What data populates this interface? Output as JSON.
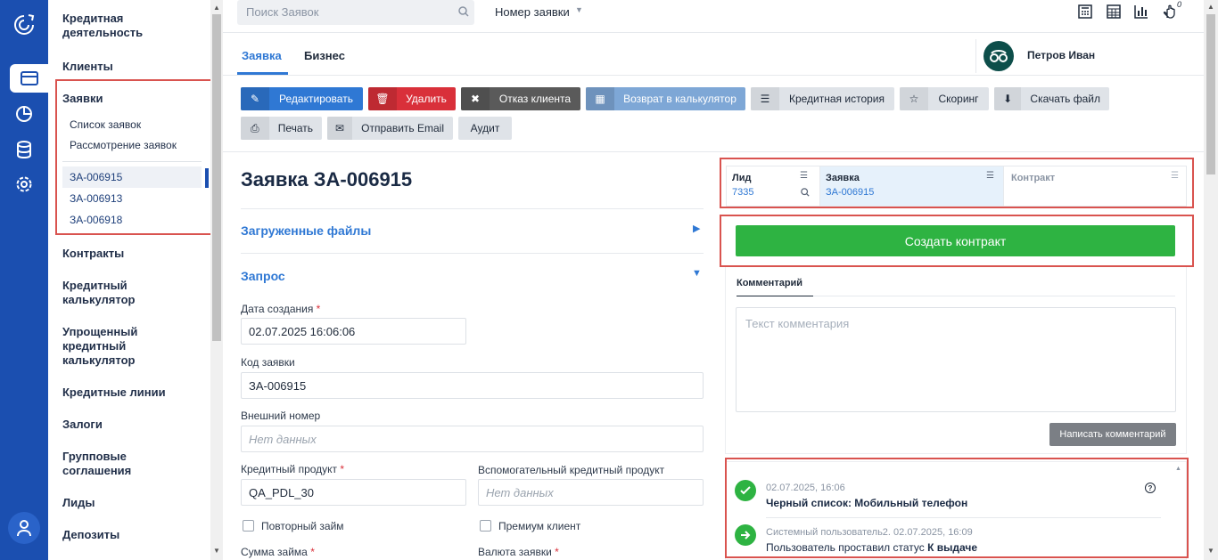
{
  "rail": {
    "items": [
      "logo-icon",
      "card-icon",
      "pie-chart-icon",
      "database-icon",
      "settings-icon",
      "user-icon"
    ]
  },
  "sidebar": {
    "title": "Кредитная деятельность",
    "clients": "Клиенты",
    "applications": "Заявки",
    "app_list": "Список заявок",
    "app_review": "Рассмотрение заявок",
    "recent": [
      "ЗА-006915",
      "ЗА-006913",
      "ЗА-006918"
    ],
    "contracts": "Контракты",
    "calc": "Кредитный калькулятор",
    "simple_calc": "Упрощенный кредитный калькулятор",
    "lines": "Кредитные линии",
    "collateral": "Залоги",
    "group": "Групповые соглашения",
    "leads": "Лиды",
    "deposits": "Депозиты"
  },
  "topbar": {
    "search_placeholder": "Поиск Заявок",
    "search_field": "Номер заявки",
    "badge": "0"
  },
  "tabs": [
    "Заявка",
    "Бизнес"
  ],
  "user": {
    "name": "Петров Иван"
  },
  "toolbar": {
    "edit": "Редактировать",
    "delete": "Удалить",
    "reject": "Отказ клиента",
    "back_calc": "Возврат в калькулятор",
    "credit_history": "Кредитная история",
    "scoring": "Скоринг",
    "download": "Скачать файл",
    "print": "Печать",
    "email": "Отправить Email",
    "audit": "Аудит"
  },
  "form": {
    "title": "Заявка ЗА-006915",
    "files": "Загруженные файлы",
    "request": "Запрос",
    "created_label": "Дата создания",
    "created_value": "02.07.2025 16:06:06",
    "code_label": "Код заявки",
    "code_value": "ЗА-006915",
    "ext_label": "Внешний номер",
    "ext_placeholder": "Нет данных",
    "product_label": "Кредитный продукт",
    "product_value": "QA_PDL_30",
    "aux_label": "Вспомогательный кредитный продукт",
    "aux_placeholder": "Нет данных",
    "repeat": "Повторный займ",
    "premium": "Премиум клиент",
    "amount_label": "Сумма займа",
    "currency_label": "Валюта заявки"
  },
  "flow": {
    "lead_label": "Лид",
    "lead_value": "7335",
    "app_label": "Заявка",
    "app_value": "ЗА-006915",
    "contract_label": "Контракт"
  },
  "create_contract": "Создать контракт",
  "comments": {
    "tab": "Комментарий",
    "placeholder": "Текст комментария",
    "submit": "Написать комментарий"
  },
  "events": [
    {
      "meta": "02.07.2025, 16:06",
      "text": "Черный список: Мобильный телефон"
    },
    {
      "meta": "Системный пользователь2. 02.07.2025, 16:09",
      "text": "Пользователь проставил статус ",
      "bold": "К выдаче"
    }
  ],
  "colors": {
    "rail": "#1b4fb0",
    "primary": "#2f78d4",
    "danger": "#d9303a",
    "dark": "#5a5a5a",
    "success": "#2eb342",
    "highlight": "#d9534f"
  }
}
